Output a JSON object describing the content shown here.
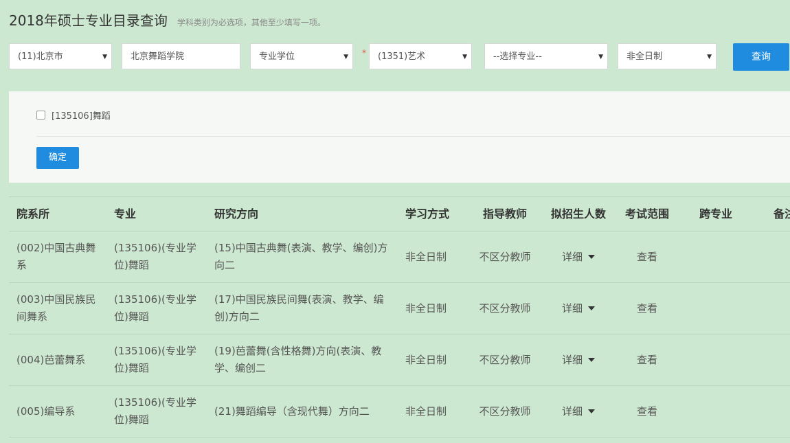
{
  "header": {
    "title": "2018年硕士专业目录查询",
    "hint": "学科类别为必选项，其他至少填写一项。"
  },
  "filters": {
    "province": "(11)北京市",
    "school": "北京舞蹈学院",
    "degree_type": "专业学位",
    "required_mark": "*",
    "category": "(1351)艺术",
    "major": "--选择专业--",
    "study_mode": "非全日制",
    "query_button": "查询"
  },
  "panel": {
    "checkbox_label": "[135106]舞蹈",
    "confirm_button": "确定"
  },
  "table": {
    "headers": [
      "院系所",
      "专业",
      "研究方向",
      "学习方式",
      "指导教师",
      "拟招生人数",
      "考试范围",
      "跨专业",
      "备注"
    ],
    "rows": [
      {
        "dept": "(002)中国古典舞系",
        "major": "(135106)(专业学位)舞蹈",
        "direction": "(15)中国古典舞(表演、教学、编创)方向二",
        "mode": "非全日制",
        "advisor": "不区分教师",
        "quota": "详细",
        "scope": "查看",
        "cross": "",
        "note": ""
      },
      {
        "dept": "(003)中国民族民间舞系",
        "major": "(135106)(专业学位)舞蹈",
        "direction": "(17)中国民族民间舞(表演、教学、编创)方向二",
        "mode": "非全日制",
        "advisor": "不区分教师",
        "quota": "详细",
        "scope": "查看",
        "cross": "",
        "note": ""
      },
      {
        "dept": "(004)芭蕾舞系",
        "major": "(135106)(专业学位)舞蹈",
        "direction": "(19)芭蕾舞(含性格舞)方向(表演、教学、编创二",
        "mode": "非全日制",
        "advisor": "不区分教师",
        "quota": "详细",
        "scope": "查看",
        "cross": "",
        "note": ""
      },
      {
        "dept": "(005)编导系",
        "major": "(135106)(专业学位)舞蹈",
        "direction": "(21)舞蹈编导（含现代舞）方向二",
        "mode": "非全日制",
        "advisor": "不区分教师",
        "quota": "详细",
        "scope": "查看",
        "cross": "",
        "note": ""
      }
    ]
  }
}
